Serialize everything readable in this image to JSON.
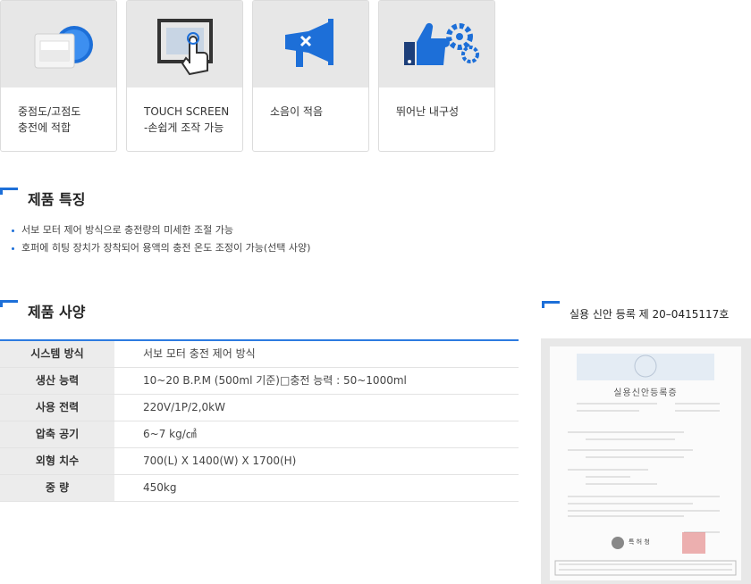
{
  "feature_cards": [
    {
      "icon": "charge-device-icon",
      "label": "중점도/고점도\n충전에 적합"
    },
    {
      "icon": "touch-screen-icon",
      "label": "TOUCH SCREEN\n-손쉽게 조작 가능"
    },
    {
      "icon": "low-noise-icon",
      "label": "소음이 적음"
    },
    {
      "icon": "durability-icon",
      "label": "뛰어난 내구성"
    }
  ],
  "features_section": {
    "title": "제품 특징",
    "items": [
      "서보 모터 제어 방식으로 충전량의 미세한 조절 가능",
      "호퍼에 히팅 장치가 장착되어 용액의 충전 온도 조정이 가능(선택 사양)"
    ]
  },
  "spec_section": {
    "title": "제품 사양",
    "rows": [
      {
        "label": "시스템 방식",
        "value": "서보 모터 충전 제어 방식"
      },
      {
        "label": "생산 능력",
        "value": "10~20 B.P.M (500ml 기준)□충전 능력 : 50~1000ml"
      },
      {
        "label": "사용 전력",
        "value": "220V/1P/2,0kW"
      },
      {
        "label": "압축 공기",
        "value": "6~7 kg/㎠"
      },
      {
        "label": "외형 치수",
        "value": "700(L) X 1400(W) X 1700(H)"
      },
      {
        "label": "중 량",
        "value": "450kg"
      }
    ]
  },
  "certificate": {
    "heading": "실용 신안 등록 제 20–0415117호",
    "doc_title": "실용신안등록증",
    "issuer": "특 허 청"
  },
  "colors": {
    "accent": "#1d6fd8",
    "card_bg": "#e7e7e7",
    "table_header_bg": "#ececec"
  }
}
